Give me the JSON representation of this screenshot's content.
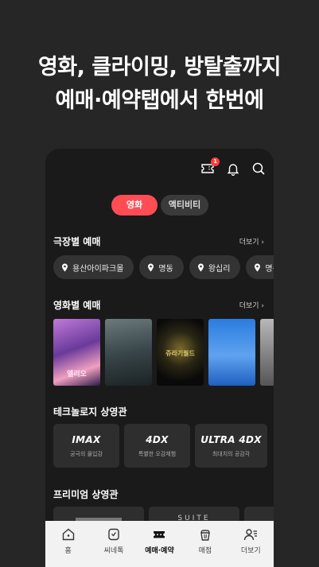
{
  "headline": {
    "line1": "영화, 클라이밍, 방탈출까지",
    "line2": "예매·예약탭에서 한번에"
  },
  "topbar": {
    "ticket_badge": "1",
    "icons": [
      "ticket-icon",
      "bell-icon",
      "search-icon"
    ]
  },
  "segment": {
    "movie": "영화",
    "activity": "액티비티",
    "active": "영화"
  },
  "theater_section": {
    "title": "극장별 예매",
    "more": "더보기",
    "chips": [
      "용산아이파크몰",
      "명동",
      "왕십리",
      "명동역 씨"
    ]
  },
  "movie_section": {
    "title": "영화별 예매",
    "more": "더보기",
    "poster_texts": [
      "엘리오",
      "쥬라기월드"
    ]
  },
  "tech_section": {
    "title": "테크놀로지 상영관",
    "cards": [
      {
        "logo": "IMAX",
        "sub": "궁극의 몰입감"
      },
      {
        "logo": "4DX",
        "sub": "특별한 오감체험"
      },
      {
        "logo": "ULTRA 4DX",
        "sub": "최대치의 공감각"
      }
    ]
  },
  "premium_section": {
    "title": "프리미엄 상영관",
    "cards": [
      "",
      "SUITE",
      ""
    ]
  },
  "nav": {
    "items": [
      "홈",
      "씨네톡",
      "예매·예약",
      "매점",
      "더보기"
    ],
    "active": "예매·예약"
  },
  "colors": {
    "accent": "#ff4c55",
    "background": "#262626",
    "nav_bg": "#f2f2f2"
  }
}
